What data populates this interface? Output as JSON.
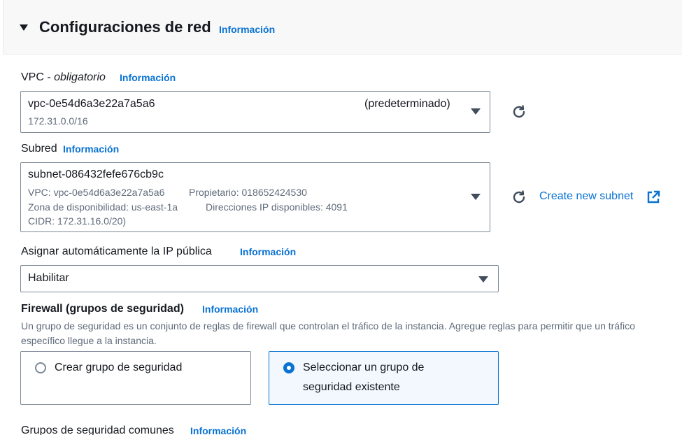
{
  "section": {
    "title": "Configuraciones de red",
    "info": "Información"
  },
  "vpc": {
    "label": "VPC - ",
    "label_italic": "obligatorio",
    "info": "Información",
    "value": "vpc-0e54d6a3e22a7a5a6",
    "tag": "(predeterminado)",
    "cidr": "172.31.0.0/16"
  },
  "subnet": {
    "label": "Subred",
    "info": "Información",
    "value": "subnet-086432fefe676cb9c",
    "vpc_line": "VPC: vpc-0e54d6a3e22a7a5a6",
    "owner_line": "Propietario: 018652424530",
    "az_line": "Zona de disponibilidad: us-east-1a",
    "ips_line": "Direcciones IP disponibles: 4091",
    "cidr_line": "CIDR: 172.31.16.0/20)",
    "create_link": "Create new subnet"
  },
  "public_ip": {
    "label": "Asignar automáticamente la IP pública",
    "info": "Información",
    "value": "Habilitar"
  },
  "firewall": {
    "label": "Firewall (grupos de seguridad)",
    "info": "Información",
    "description": "Un grupo de seguridad es un conjunto de reglas de firewall que controlan el tráfico de la instancia. Agregue reglas para permitir que un tráfico específico llegue a la instancia.",
    "option_create": "Crear grupo de seguridad",
    "option_select": "Seleccionar un grupo de seguridad existente",
    "selected": "select"
  },
  "common_groups": {
    "label": "Grupos de seguridad comunes",
    "info": "Información"
  },
  "colors": {
    "link": "#0972d3",
    "selected_bg": "#f2f8fd",
    "border": "#7d8998"
  },
  "icons": {
    "collapse": "caret-down-icon",
    "dropdown": "dropdown-arrow-icon",
    "refresh": "refresh-icon",
    "external": "external-link-icon"
  }
}
